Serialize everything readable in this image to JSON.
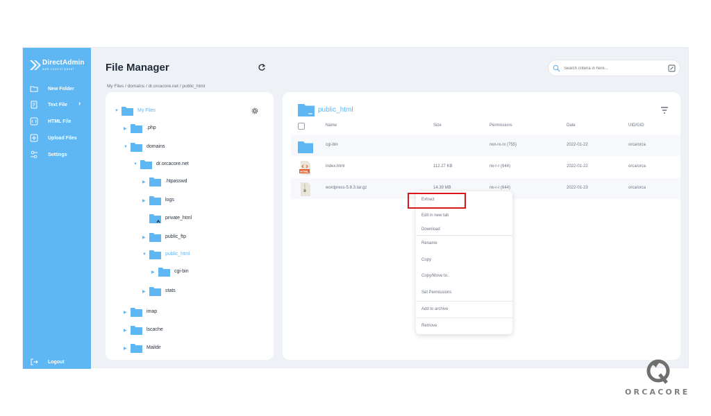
{
  "brand": {
    "name": "DirectAdmin",
    "tagline": "web control panel"
  },
  "sidebar": {
    "items": [
      {
        "label": "New Folder",
        "icon": "folder-icon"
      },
      {
        "label": "Text File",
        "icon": "text-file-icon",
        "has_submenu": true
      },
      {
        "label": "HTML File",
        "icon": "html-file-icon"
      },
      {
        "label": "Upload Files",
        "icon": "upload-icon"
      },
      {
        "label": "Settings",
        "icon": "settings-icon"
      }
    ],
    "logout": {
      "label": "Logout",
      "icon": "logout-icon"
    }
  },
  "header": {
    "title": "File Manager",
    "breadcrumb": "My Files  /  domains  /  dr.orcacore.net  /  public_html",
    "search_placeholder": "Search criteria in here..."
  },
  "tree": {
    "root": "My Files",
    "items": [
      {
        "label": ".php"
      },
      {
        "label": "domains"
      },
      {
        "label": "dr.orcacore.net"
      },
      {
        "label": ".htpasswd"
      },
      {
        "label": "logs"
      },
      {
        "label": "private_html"
      },
      {
        "label": "public_ftp"
      },
      {
        "label": "public_html",
        "active": true
      },
      {
        "label": "cgi-bin"
      },
      {
        "label": "stats"
      },
      {
        "label": "imap"
      },
      {
        "label": "lscache"
      },
      {
        "label": "Maildir"
      }
    ]
  },
  "list": {
    "folder_title": "public_html",
    "columns": {
      "name": "Name",
      "size": "Size",
      "permissions": "Permissions",
      "date": "Date",
      "uid": "UID/GID"
    },
    "rows": [
      {
        "name": "cgi-bin",
        "size": "",
        "permissions": "rwx-rx-rx (755)",
        "date": "2022-01-22",
        "uid": "orca/orca",
        "type": "folder"
      },
      {
        "name": "index.html",
        "size": "112.27 KB",
        "permissions": "rw-r-r (644)",
        "date": "2022-01-22",
        "uid": "orca/orca",
        "type": "html"
      },
      {
        "name": "wordpress-5.8.3.tar.gz",
        "size": "14.39 MB",
        "permissions": "rw-r-r (644)",
        "date": "2022-01-23",
        "uid": "orca/orca",
        "type": "archive"
      }
    ]
  },
  "context_menu": {
    "items": [
      {
        "label": "Extract"
      },
      {
        "label": "Edit in new tab"
      },
      {
        "label": "Download"
      },
      {
        "label": "Rename"
      },
      {
        "label": "Copy"
      },
      {
        "label": "Copy/Move to.."
      },
      {
        "label": "Set Permissions"
      },
      {
        "label": "Add to archive"
      },
      {
        "label": "Remove"
      }
    ]
  },
  "watermark": {
    "text": "ORCACORE"
  },
  "colors": {
    "accent": "#5eb6f2",
    "highlight": "#d8151b",
    "panel_bg": "#eef1f6"
  }
}
